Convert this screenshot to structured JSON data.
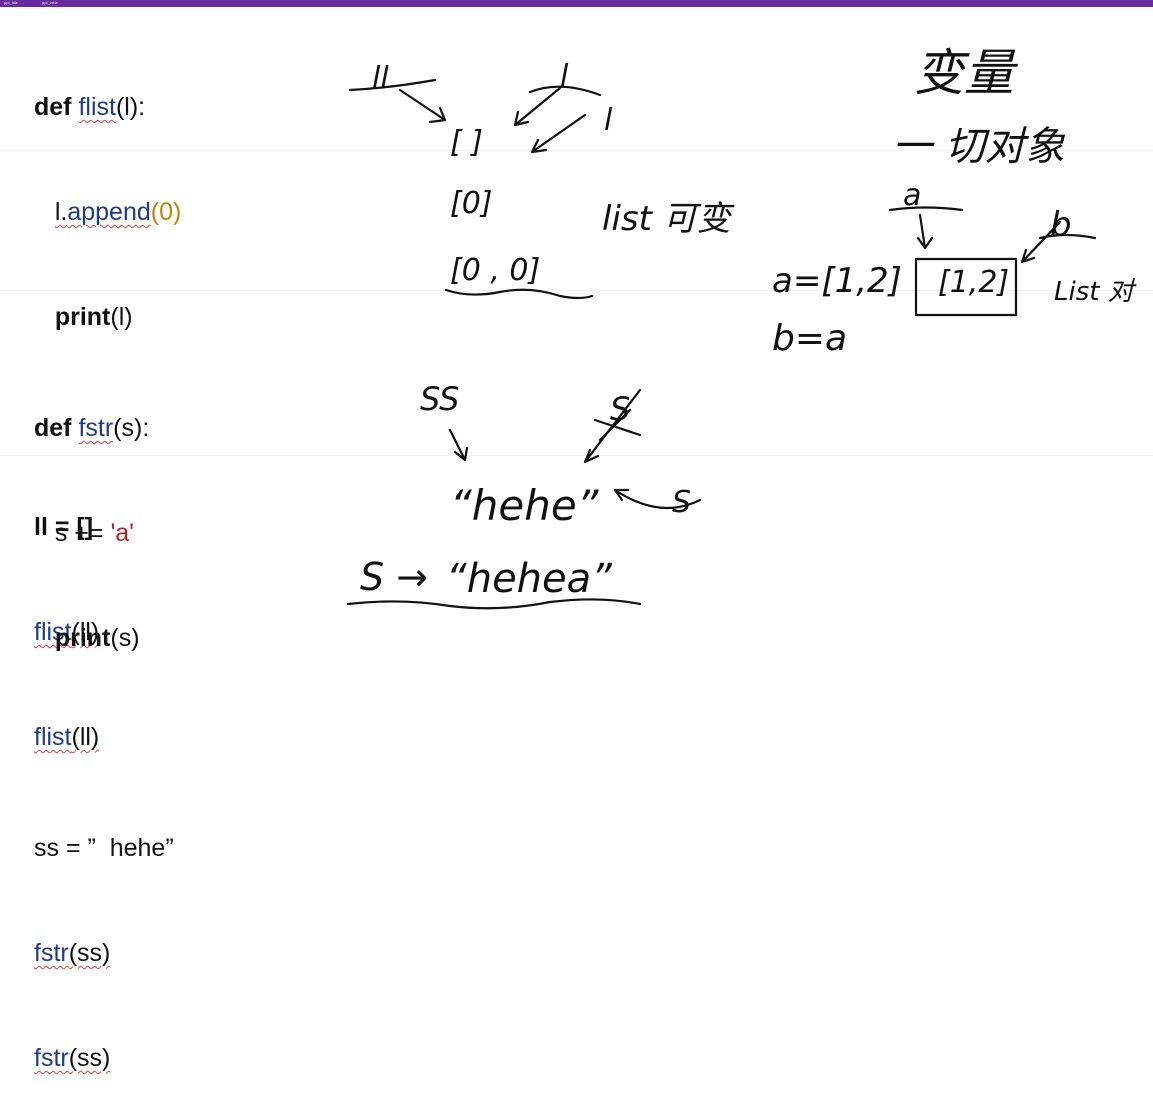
{
  "topbar": {
    "tab1": "ppt_title",
    "tab2": "ppt_view"
  },
  "code_block_1": {
    "def_kw": "def",
    "fn_name": "flist",
    "fn_params": "(l):",
    "body_l": "l.",
    "append": "append",
    "paren_open": "(",
    "zero": "0",
    "paren_close": ")",
    "print_kw": "print",
    "print_args": "(l)",
    "ll_assign": "ll = []",
    "call_fn": "flist",
    "call_args": "(ll)"
  },
  "code_block_2": {
    "def_kw": "def",
    "fn_name": "fstr",
    "fn_params": "(s):",
    "aug_assign": "s += ",
    "str_a": "'a'",
    "print_kw": "print",
    "print_args": "(s)",
    "ss_assign": "ss = ”  hehe”",
    "call_fn": "fstr",
    "call_args": "(ss)"
  },
  "ink": {
    "ll_label": "ll",
    "l_label": "l",
    "l_label2": "l",
    "empty_list": "[ ]",
    "list_zero": "[0]",
    "list_zero_zero": "[0 , 0]",
    "list_mutable": "list 可变",
    "bianliang": "变量",
    "yiqie_duixiang": "一 切对象",
    "a_label": "a",
    "b_label": "b",
    "a_assign": "a=[1,2]",
    "box_value": "[1,2]",
    "list_note": "List 对",
    "b_assign": "b=a",
    "ss_label": "SS",
    "s_label": "S",
    "s_label2": "S",
    "hehe": "“hehe”",
    "s_arrow": "S →",
    "hehea": "“hehea”"
  }
}
